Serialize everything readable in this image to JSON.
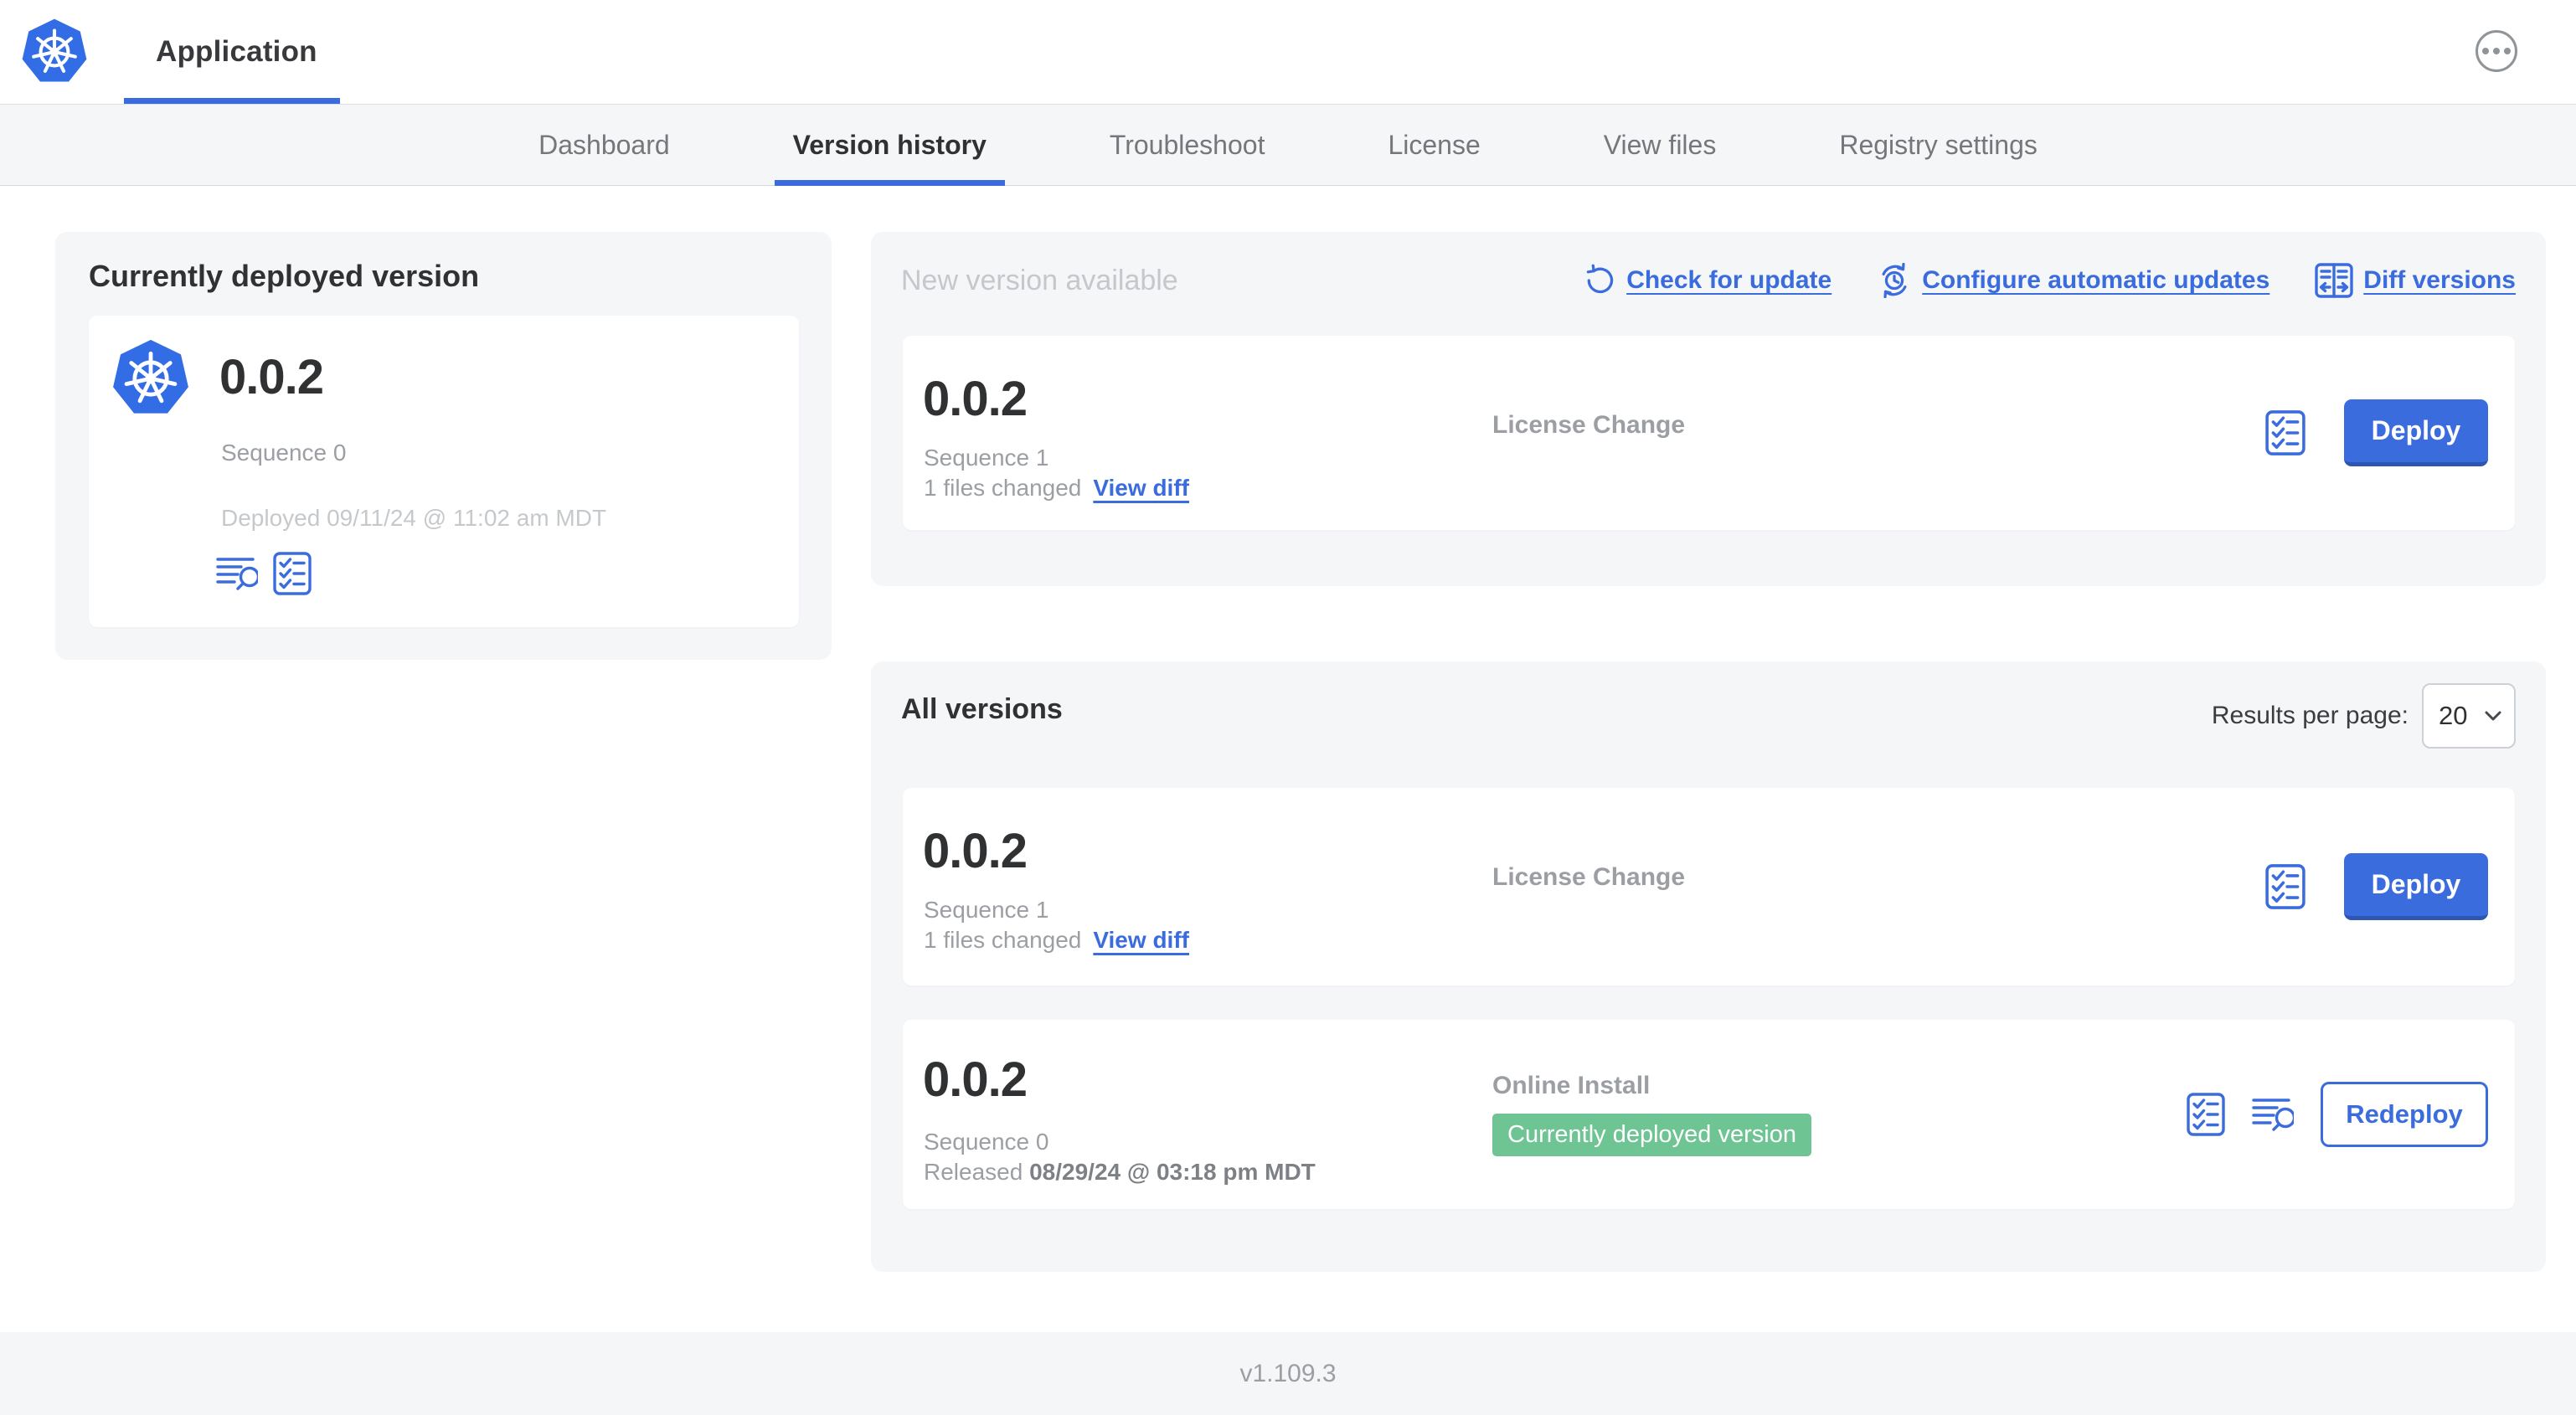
{
  "app": {
    "title": "Application",
    "footer_version": "v1.109.3"
  },
  "colors": {
    "accent_blue": "#3b6cde",
    "logo_blue": "#326de6",
    "badge_green": "#6fc493",
    "panel_bg": "#f4f6f8",
    "text_dark": "#2f3133",
    "text_gray": "#9b9fa4",
    "text_light_gray": "#c4c8cc"
  },
  "tabs": [
    {
      "label": "Dashboard",
      "active": false
    },
    {
      "label": "Version history",
      "active": true
    },
    {
      "label": "Troubleshoot",
      "active": false
    },
    {
      "label": "License",
      "active": false
    },
    {
      "label": "View files",
      "active": false
    },
    {
      "label": "Registry settings",
      "active": false
    }
  ],
  "current": {
    "heading": "Currently deployed version",
    "version": "0.0.2",
    "sequence": "Sequence 0",
    "deployed": "Deployed 09/11/24 @ 11:02 am MDT"
  },
  "new_version": {
    "heading": "New version available",
    "links": {
      "check_for_update": "Check for update",
      "configure_automatic_updates": "Configure automatic updates",
      "diff_versions": "Diff versions"
    },
    "card": {
      "version": "0.0.2",
      "sequence": "Sequence 1",
      "files_changed": "1 files changed",
      "view_diff": "View diff",
      "source": "License Change",
      "action_label": "Deploy"
    }
  },
  "all_versions": {
    "heading": "All versions",
    "results_per_page_label": "Results per page:",
    "results_per_page_value": "20",
    "rows": [
      {
        "version": "0.0.2",
        "sequence": "Sequence 1",
        "files_changed": "1 files changed",
        "view_diff": "View diff",
        "source": "License Change",
        "action_label": "Deploy"
      },
      {
        "version": "0.0.2",
        "sequence": "Sequence 0",
        "released_label": "Released",
        "released_date": "08/29/24 @ 03:18 pm MDT",
        "source": "Online Install",
        "badge": "Currently deployed version",
        "action_label": "Redeploy"
      }
    ]
  }
}
